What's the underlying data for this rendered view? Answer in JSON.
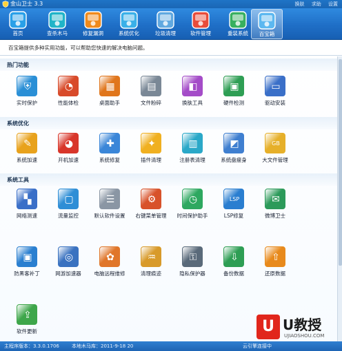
{
  "window": {
    "title": "金山卫士 3.3",
    "links": [
      "换肤",
      "求助",
      "设置"
    ]
  },
  "toolbar": {
    "items": [
      {
        "label": "首页",
        "icon": "home-icon",
        "color": "#29a0e8"
      },
      {
        "label": "查杀木马",
        "icon": "trojan-scan-icon",
        "color": "#20b4c8"
      },
      {
        "label": "修复漏洞",
        "icon": "patch-icon",
        "color": "#f08a1c"
      },
      {
        "label": "系统优化",
        "icon": "system-optimize-icon",
        "color": "#3ab0e8"
      },
      {
        "label": "垃圾清理",
        "icon": "garbage-clean-icon",
        "color": "#60a8e0"
      },
      {
        "label": "软件管理",
        "icon": "software-manage-icon",
        "color": "#e84c3a"
      },
      {
        "label": "重装系统",
        "icon": "reinstall-icon",
        "color": "#38b060"
      },
      {
        "label": "百宝箱",
        "icon": "toolbox-icon",
        "color": "#5cb8f0"
      }
    ],
    "active_index": 7
  },
  "subtitle": "百宝箱提供多种实用功能，可以帮助您快速的解决电脑问题。",
  "sections": [
    {
      "title": "热门功能",
      "tools": [
        {
          "label": "实时保护",
          "icon": "shield-icon",
          "color": "#2a8fd6",
          "glyph": "⛨"
        },
        {
          "label": "性能体检",
          "icon": "gauge-icon",
          "color": "#d84a2a",
          "glyph": "◔"
        },
        {
          "label": "桌面助手",
          "icon": "desktop-assistant-icon",
          "color": "#e0761c",
          "glyph": "▦"
        },
        {
          "label": "文件粉碎",
          "icon": "shredder-icon",
          "color": "#7a8896",
          "glyph": "▤"
        },
        {
          "label": "换肤工具",
          "icon": "skin-icon",
          "color": "#a44cc8",
          "glyph": "◧"
        },
        {
          "label": "硬件检测",
          "icon": "hardware-icon",
          "color": "#2e9e54",
          "glyph": "▣"
        },
        {
          "label": "驱动安装",
          "icon": "driver-icon",
          "color": "#3a6fc8",
          "glyph": "▭"
        }
      ]
    },
    {
      "title": "系统优化",
      "tools": [
        {
          "label": "系统加速",
          "icon": "rocket-icon",
          "color": "#e8a21c",
          "glyph": "✎"
        },
        {
          "label": "开机加速",
          "icon": "boot-speed-icon",
          "color": "#d8362a",
          "glyph": "◕"
        },
        {
          "label": "系统修复",
          "icon": "wrench-icon",
          "color": "#3a86d8",
          "glyph": "✚"
        },
        {
          "label": "插件清理",
          "icon": "puzzle-icon",
          "color": "#f0b020",
          "glyph": "✦"
        },
        {
          "label": "注册表清理",
          "icon": "registry-icon",
          "color": "#2aa8c8",
          "glyph": "▥"
        },
        {
          "label": "系统盘瘦身",
          "icon": "disk-slim-icon",
          "color": "#3f7fd0",
          "glyph": "◩"
        },
        {
          "label": "大文件管理",
          "icon": "big-file-icon",
          "color": "#e6b02a",
          "glyph": "GB"
        }
      ]
    },
    {
      "title": "系统工具",
      "tools": [
        {
          "label": "网络测速",
          "icon": "network-speed-icon",
          "color": "#3a6fc8",
          "glyph": "▚"
        },
        {
          "label": "流量监控",
          "icon": "traffic-monitor-icon",
          "color": "#2e8ed6",
          "glyph": "▢"
        },
        {
          "label": "默认软件设置",
          "icon": "default-software-icon",
          "color": "#8a96a4",
          "glyph": "☰"
        },
        {
          "label": "右键菜单管理",
          "icon": "context-menu-icon",
          "color": "#d8522a",
          "glyph": "⚙"
        },
        {
          "label": "时间保护助手",
          "icon": "time-protect-icon",
          "color": "#2ea860",
          "glyph": "◷"
        },
        {
          "label": "LSP修复",
          "icon": "lsp-repair-icon",
          "color": "#2a7ed0",
          "glyph": "LSP"
        },
        {
          "label": "微博卫士",
          "icon": "weibo-guard-icon",
          "color": "#2c9a5a",
          "glyph": "✉"
        }
      ]
    },
    {
      "title": "",
      "tools": [
        {
          "label": "防黑客补丁",
          "icon": "anti-hacker-patch-icon",
          "color": "#2a7fd0",
          "glyph": "▣"
        },
        {
          "label": "网游加速器",
          "icon": "game-accelerator-icon",
          "color": "#3a72c0",
          "glyph": "◎"
        },
        {
          "label": "电脑远程维修",
          "icon": "remote-repair-icon",
          "color": "#e0762a",
          "glyph": "✿"
        },
        {
          "label": "清理痕迹",
          "icon": "broom-icon",
          "color": "#d89a2a",
          "glyph": "♒"
        },
        {
          "label": "隐私保护器",
          "icon": "privacy-lock-icon",
          "color": "#5a6a7a",
          "glyph": "⚿"
        },
        {
          "label": "备份数据",
          "icon": "backup-icon",
          "color": "#2e9e54",
          "glyph": "⇩"
        },
        {
          "label": "还原数据",
          "icon": "restore-icon",
          "color": "#e88a1c",
          "glyph": "⇧"
        }
      ]
    },
    {
      "title": "",
      "tools": [
        {
          "label": "软件更新",
          "icon": "software-update-icon",
          "color": "#3ea64a",
          "glyph": "⇪"
        }
      ]
    }
  ],
  "statusbar": {
    "version": "主程序版本：3.3.0.1706",
    "virus_db": "本地木马库：2011-9-18 20",
    "cloud": "云引擎连接中"
  },
  "watermark": {
    "logo_text": "U",
    "title": "U教授",
    "url": "UJIAOSHOU.COM",
    "accent": "#e1261c"
  }
}
